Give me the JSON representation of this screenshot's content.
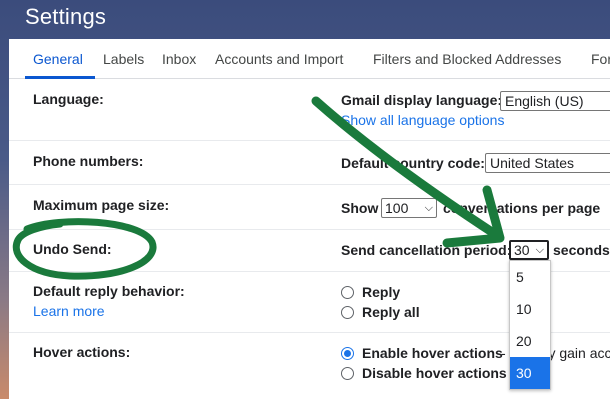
{
  "page": {
    "title": "Settings"
  },
  "tabs": [
    {
      "label": "General"
    },
    {
      "label": "Labels"
    },
    {
      "label": "Inbox"
    },
    {
      "label": "Accounts and Import"
    },
    {
      "label": "Filters and Blocked Addresses"
    },
    {
      "label": "For"
    }
  ],
  "language": {
    "label": "Language:",
    "display_label": "Gmail display language:",
    "display_value": "English (US)",
    "show_all_link": "Show all language options"
  },
  "phone": {
    "label": "Phone numbers:",
    "country_label": "Default country code:",
    "country_value": "United States"
  },
  "page_size": {
    "label": "Maximum page size:",
    "show_label": "Show",
    "value": "100",
    "suffix": "conversations per page"
  },
  "undo_send": {
    "label": "Undo Send:",
    "period_label": "Send cancellation period:",
    "value": "30",
    "unit": "seconds",
    "options": [
      "5",
      "10",
      "20",
      "30"
    ],
    "selected": "30"
  },
  "reply": {
    "label": "Default reply behavior:",
    "learn_more": "Learn more",
    "options": [
      "Reply",
      "Reply all"
    ]
  },
  "hover": {
    "label": "Hover actions:",
    "enable": "Enable hover actions",
    "enable_desc": "- Quickly gain acc",
    "disable": "Disable hover actions"
  },
  "annotation": {
    "color": "#1a7a3c"
  },
  "colors": {
    "accent": "#0b57d0",
    "link": "#1a73e8"
  }
}
